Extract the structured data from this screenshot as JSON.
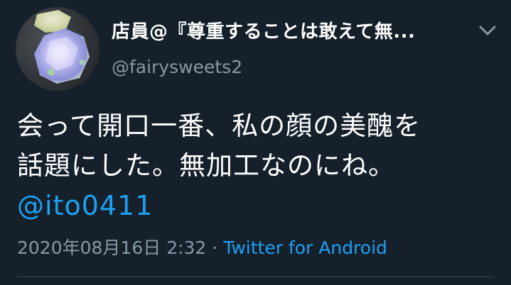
{
  "author": {
    "display_name": "店員@『尊重することは敢えて無...",
    "handle": "@fairysweets2"
  },
  "icons": {
    "more": "chevron-down-icon",
    "avatar": "crystal-photo-avatar"
  },
  "tweet": {
    "lines": [
      "会って開口一番、私の顔の美醜を",
      "話題にした。無加工なのにね。"
    ],
    "mention": "@ito0411"
  },
  "meta": {
    "timestamp": "2020年08月16日 2:32",
    "separator": " · ",
    "source": "Twitter for Android"
  },
  "colors": {
    "background": "#15202b",
    "text": "#ffffff",
    "secondary": "#8899a6",
    "link": "#1da1f2"
  }
}
